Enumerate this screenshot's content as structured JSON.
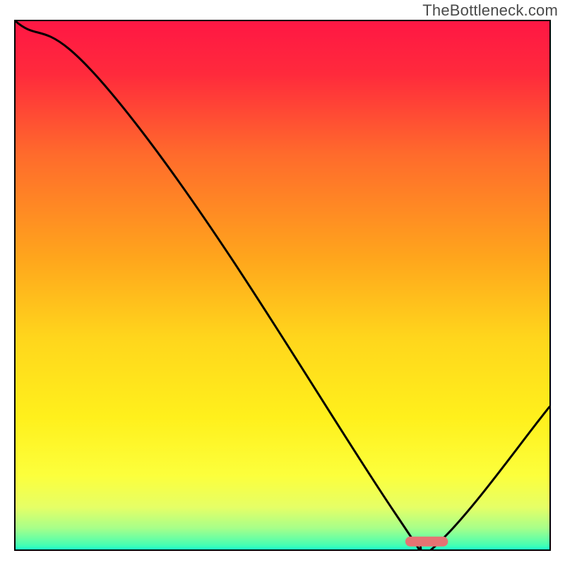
{
  "watermark": {
    "text": "TheBottleneck.com"
  },
  "chart_data": {
    "type": "line",
    "title": "",
    "xlabel": "",
    "ylabel": "",
    "xlim": [
      0,
      100
    ],
    "ylim": [
      0,
      100
    ],
    "series": [
      {
        "name": "curve",
        "x": [
          0,
          23,
          71,
          75,
          80,
          100
        ],
        "values": [
          100,
          80,
          7,
          2,
          2,
          27
        ]
      }
    ],
    "marker": {
      "x_start": 73,
      "x_end": 81,
      "y": 1.5
    },
    "gradient_stops": [
      {
        "offset": 0,
        "color": "#ff1744"
      },
      {
        "offset": 10,
        "color": "#ff2a3c"
      },
      {
        "offset": 25,
        "color": "#ff6a2c"
      },
      {
        "offset": 45,
        "color": "#ffa61c"
      },
      {
        "offset": 60,
        "color": "#ffd61c"
      },
      {
        "offset": 75,
        "color": "#fff01c"
      },
      {
        "offset": 86,
        "color": "#fcff3c"
      },
      {
        "offset": 92,
        "color": "#e6ff66"
      },
      {
        "offset": 96,
        "color": "#a6ff8a"
      },
      {
        "offset": 99,
        "color": "#4cffb0"
      },
      {
        "offset": 100,
        "color": "#1effc8"
      }
    ],
    "axes_visible": false,
    "grid": false,
    "legend": false
  }
}
